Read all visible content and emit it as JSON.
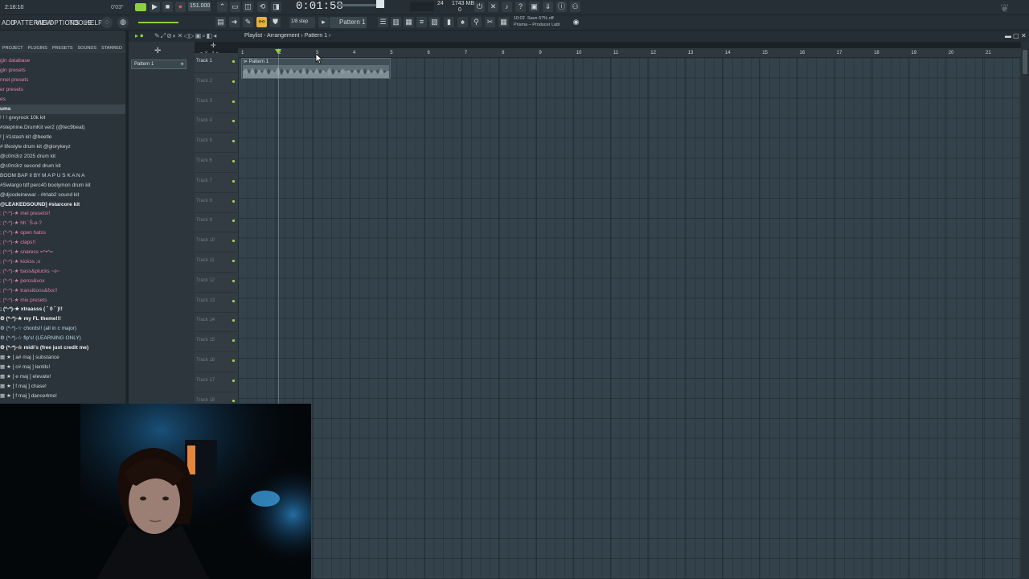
{
  "topbar": {
    "clock": "2:16:10",
    "tempo": "151.000",
    "time_display": "0:01:58",
    "cpu": "24",
    "ram": "1743 MB",
    "ram2": "0",
    "counter": "0'03\"",
    "hint_time": "10:02",
    "hint_line1": "Save 67% off",
    "hint_line2": "Prisma – Producer Labl",
    "step": "1/8 step",
    "pattern": "Pattern 1"
  },
  "menu": [
    "ADD",
    "PATTERNS",
    "VIEW",
    "OPTIONS",
    "TOOLS",
    "HELP"
  ],
  "browser": {
    "tabs": [
      "PROJECT",
      "PLUGINS",
      "PRESETS",
      "SOUNDS",
      "STARRED"
    ],
    "rows": [
      {
        "text": "gin database",
        "style": "pink"
      },
      {
        "text": "gin presets",
        "style": "pink"
      },
      {
        "text": "nnel presets",
        "style": "pink"
      },
      {
        "text": "er presets",
        "style": "pink"
      },
      {
        "text": "es",
        "style": "pink"
      },
      {
        "text": "ums",
        "style": "header"
      },
      {
        "text": "! ! ! greyrock 10k kit",
        "style": "light"
      },
      {
        "text": "#stepnine.DrumKit ver2 (@tec9beat)",
        "style": "light"
      },
      {
        "text": "! ] #1stash kit @beetle",
        "style": "light"
      },
      {
        "text": "# lifestyle drum kit @glorykeyz",
        "style": "light"
      },
      {
        "text": "@c0m3rz 2025 drum kit",
        "style": "light"
      },
      {
        "text": "@c0m3rz second drum kit",
        "style": "light"
      },
      {
        "text": "BOOM BAP II BY M A P U S K A N A",
        "style": "light"
      },
      {
        "text": "#Swlargo tdf perc40 boolymon drum kit",
        "style": "light"
      },
      {
        "text": "@djcodeinewar - #trlab2 sound kit",
        "style": "light"
      },
      {
        "text": "@LEAKEDSOUND] #starcore kit",
        "style": "bold"
      },
      {
        "text": "; (*ᵕ*)-★ mel presets!!",
        "style": "pink"
      },
      {
        "text": "; (*ᵕ*)-★ hh ¨Ś-ʚ-?",
        "style": "pink"
      },
      {
        "text": "; (*ᵕ*)-★ open hatss",
        "style": "pink"
      },
      {
        "text": "; (*ᵕ*)-★ claps!!",
        "style": "pink"
      },
      {
        "text": "; (*ᵕ*)-★ snaress =^•^=",
        "style": "pink"
      },
      {
        "text": "; (*ᵕ*)-★ kickss ;o",
        "style": "pink"
      },
      {
        "text": "; (*ᵕ*)-★ bass&plucks ~ʚ~",
        "style": "pink"
      },
      {
        "text": "; (*ᵕ*)-★ percs&vox",
        "style": "pink"
      },
      {
        "text": "; (*ᵕ*)-★ transitions&fxs!!",
        "style": "pink"
      },
      {
        "text": "; (*ᵕ*)-★ mix presets",
        "style": "pink"
      },
      {
        "text": "; (*ᵕ*)-★ xtraasss ( ˘ 0 ˘ )!!",
        "style": "bold"
      },
      {
        "text": "⚙ (*ᵕ*)-★ my FL theme!!!",
        "style": "bold"
      },
      {
        "text": "⚙ (*ᵕ*)-☆ chords!! (all in c major)",
        "style": "blue"
      },
      {
        "text": "⚙ (*ᵕ*)-☆ flp's! (LEARNING ONLY)",
        "style": "blue"
      },
      {
        "text": "⚙ (*ᵕ*)-☆ midi's (free just credit me)",
        "style": "bold"
      },
      {
        "text": "   ▦ ★ [ a# maj ] substance",
        "style": "light"
      },
      {
        "text": "   ▦ ★ [ c# maj ] lentils!",
        "style": "light"
      },
      {
        "text": "   ▦ ★ [ e maj ] elevate!",
        "style": "light"
      },
      {
        "text": "   ▦ ★ [ f maj ] chase!",
        "style": "light"
      },
      {
        "text": "   ▦ ★ [ f maj ] dance4me!",
        "style": "light"
      }
    ]
  },
  "pattern_list": {
    "item": "Pattern 1"
  },
  "playlist": {
    "title": "Playlist - Arrangement › Pattern 1 ›",
    "clip_label": "⊳ Pattern 1",
    "tracks": [
      "Track 1",
      "Track 2",
      "Track 3",
      "Track 4",
      "Track 5",
      "Track 6",
      "Track 7",
      "Track 8",
      "Track 9",
      "Track 10",
      "Track 11",
      "Track 12",
      "Track 13",
      "Track 14",
      "Track 15",
      "Track 16",
      "Track 17",
      "Track 18"
    ],
    "ruler": [
      "1",
      "2",
      "3",
      "4",
      "5",
      "6",
      "7",
      "8",
      "9",
      "10",
      "11",
      "12",
      "13",
      "14",
      "15",
      "16",
      "17",
      "18",
      "19",
      "20",
      "21"
    ]
  },
  "colors": {
    "accent_green": "#8bd13b",
    "pink": "#e07fb1",
    "grid": "#34424b"
  }
}
